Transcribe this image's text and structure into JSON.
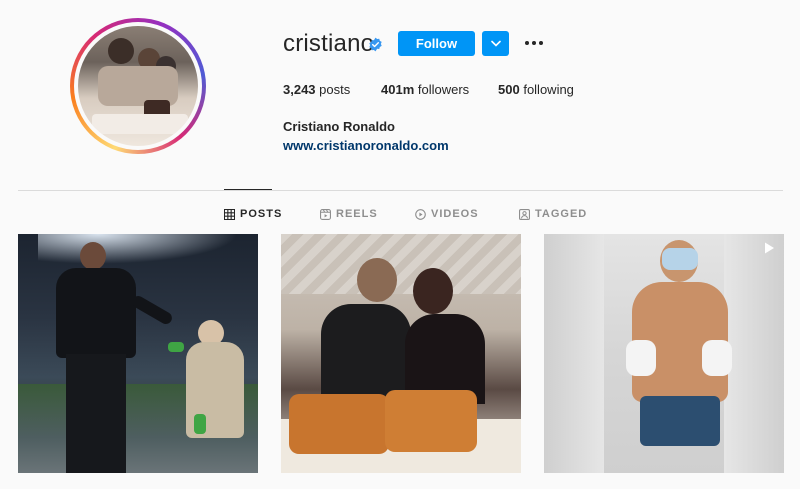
{
  "profile": {
    "username": "cristiano",
    "verified": true,
    "follow_label": "Follow",
    "full_name": "Cristiano Ronaldo",
    "website": "www.cristianoronaldo.com"
  },
  "stats": {
    "posts_count": "3,243",
    "posts_label": "posts",
    "followers_count": "401m",
    "followers_label": "followers",
    "following_count": "500",
    "following_label": "following"
  },
  "tabs": [
    {
      "label": "POSTS",
      "icon": "grid-icon",
      "active": true
    },
    {
      "label": "REELS",
      "icon": "reels-icon",
      "active": false
    },
    {
      "label": "VIDEOS",
      "icon": "video-icon",
      "active": false
    },
    {
      "label": "TAGGED",
      "icon": "tagged-icon",
      "active": false
    }
  ],
  "posts": [
    {
      "kind": "photo",
      "icon": null
    },
    {
      "kind": "photo",
      "icon": null
    },
    {
      "kind": "video",
      "icon": "video-play-icon"
    }
  ],
  "colors": {
    "accent": "#0095f6",
    "link": "#00376b",
    "text": "#262626",
    "muted": "#8e8e8e",
    "divider": "#dbdbdb",
    "background": "#fafafa"
  }
}
